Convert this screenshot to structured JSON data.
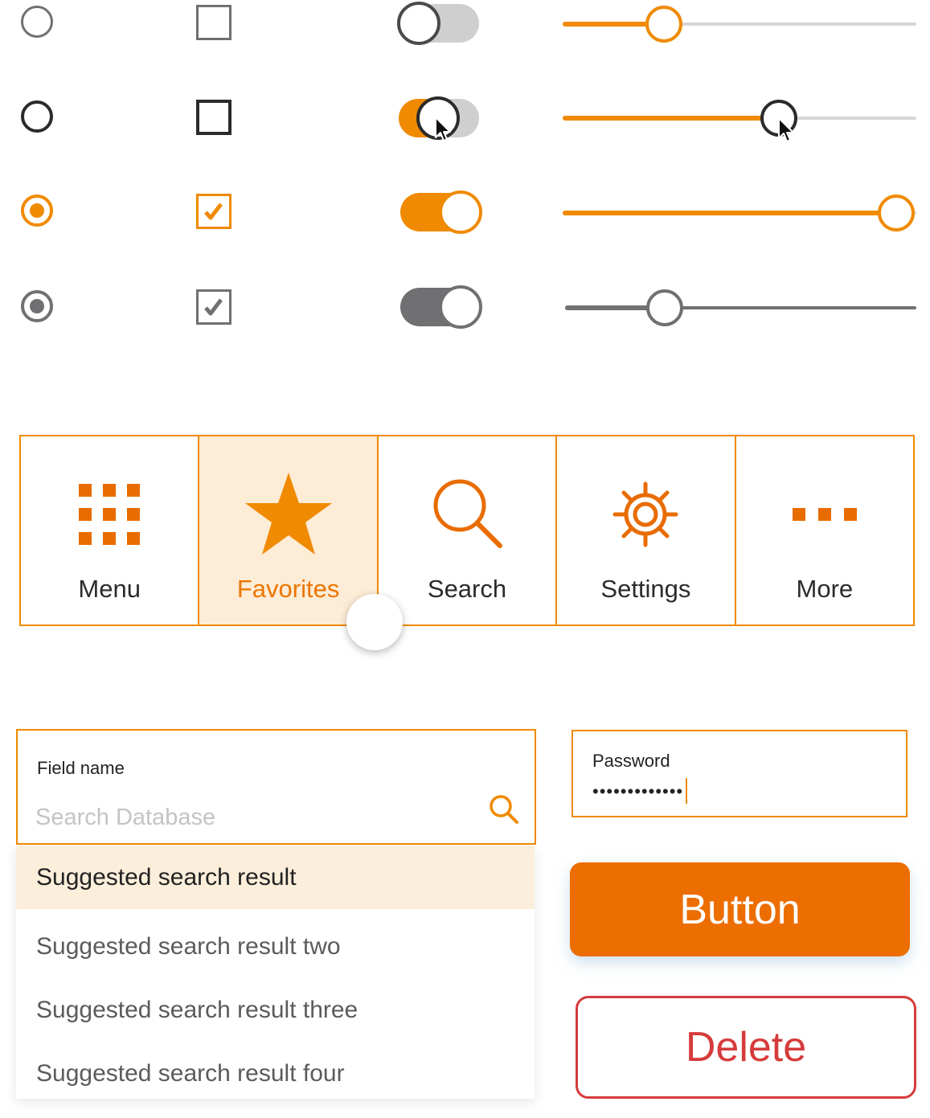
{
  "colors": {
    "accent": "#f08a00",
    "accent_dark": "#ec6d00",
    "inactive_gray": "#707073",
    "danger": "#d63b3b",
    "selected_bg": "#fdecd6"
  },
  "controls": {
    "radios": [
      {
        "state": "default"
      },
      {
        "state": "hover"
      },
      {
        "state": "selected"
      },
      {
        "state": "disabled-selected"
      }
    ],
    "checkboxes": [
      {
        "state": "default",
        "checked": false
      },
      {
        "state": "hover",
        "checked": false
      },
      {
        "state": "checked",
        "checked": true
      },
      {
        "state": "disabled-checked",
        "checked": true
      }
    ],
    "toggles": [
      {
        "state": "off",
        "on": false
      },
      {
        "state": "pressed",
        "on": false
      },
      {
        "state": "on",
        "on": true
      },
      {
        "state": "disabled-on",
        "on": true
      }
    ],
    "sliders": [
      {
        "state": "default",
        "value": 0.28
      },
      {
        "state": "dragging",
        "value": 0.62
      },
      {
        "state": "max",
        "value": 1.0
      },
      {
        "state": "disabled",
        "value": 0.28
      }
    ]
  },
  "tabbar": {
    "tabs": [
      {
        "label": "Menu",
        "icon": "grid-icon",
        "active": false
      },
      {
        "label": "Favorites",
        "icon": "star-icon",
        "active": true
      },
      {
        "label": "Search",
        "icon": "search-icon",
        "active": false
      },
      {
        "label": "Settings",
        "icon": "gear-icon",
        "active": false
      },
      {
        "label": "More",
        "icon": "more-icon",
        "active": false
      }
    ]
  },
  "search_field": {
    "label": "Field name",
    "placeholder": "Search Database",
    "value": ""
  },
  "suggestions": [
    "Suggested search result",
    "Suggested search result two",
    "Suggested search result three",
    "Suggested search result four"
  ],
  "password_field": {
    "label": "Password",
    "masked_value": "•••••••••••••"
  },
  "buttons": {
    "primary_label": "Button",
    "delete_label": "Delete"
  }
}
